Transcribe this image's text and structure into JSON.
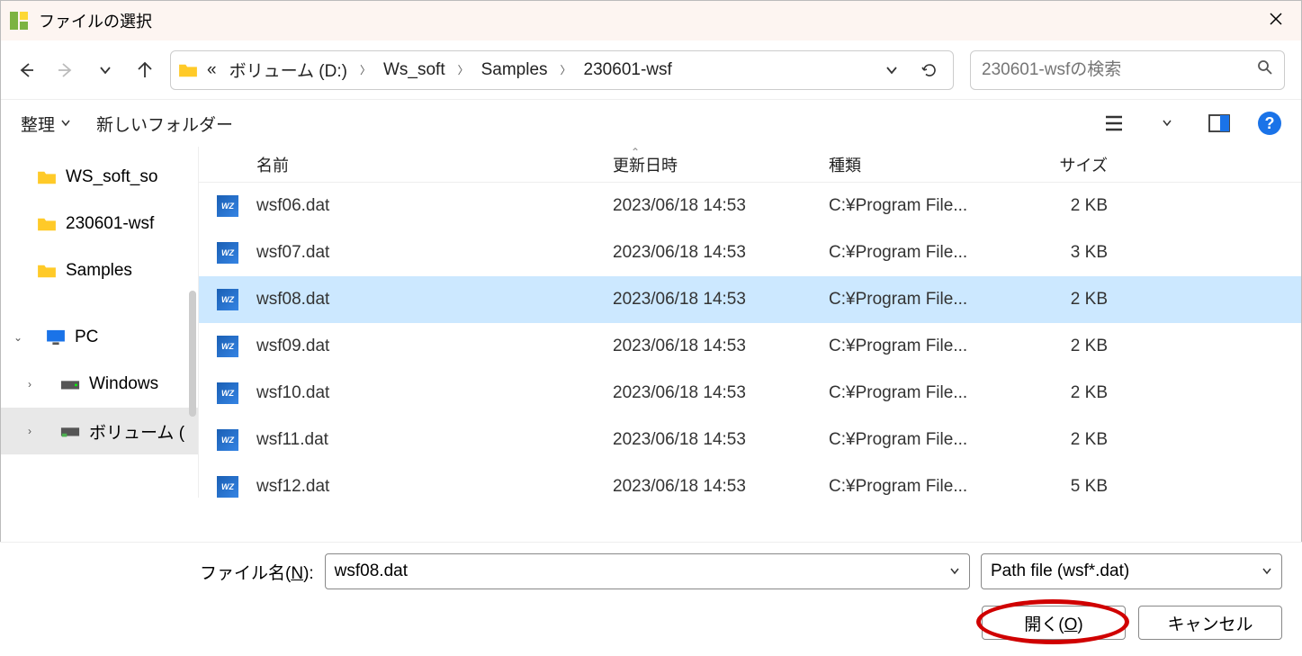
{
  "titlebar": {
    "title": "ファイルの選択"
  },
  "breadcrumb": {
    "parts": [
      "ボリューム (D:)",
      "Ws_soft",
      "Samples",
      "230601-wsf"
    ]
  },
  "search": {
    "placeholder": "230601-wsfの検索"
  },
  "toolbar": {
    "organize": "整理",
    "newfolder": "新しいフォルダー"
  },
  "sidebar": {
    "items": [
      {
        "label": "WS_soft_so"
      },
      {
        "label": "230601-wsf"
      },
      {
        "label": "Samples"
      }
    ],
    "pc": "PC",
    "drives": [
      {
        "label": "Windows"
      },
      {
        "label": "ボリューム ("
      }
    ]
  },
  "columns": {
    "name": "名前",
    "date": "更新日時",
    "type": "種類",
    "size": "サイズ"
  },
  "files": [
    {
      "name": "wsf06.dat",
      "date": "2023/06/18 14:53",
      "type": "C:¥Program File...",
      "size": "2 KB",
      "selected": false
    },
    {
      "name": "wsf07.dat",
      "date": "2023/06/18 14:53",
      "type": "C:¥Program File...",
      "size": "3 KB",
      "selected": false
    },
    {
      "name": "wsf08.dat",
      "date": "2023/06/18 14:53",
      "type": "C:¥Program File...",
      "size": "2 KB",
      "selected": true
    },
    {
      "name": "wsf09.dat",
      "date": "2023/06/18 14:53",
      "type": "C:¥Program File...",
      "size": "2 KB",
      "selected": false
    },
    {
      "name": "wsf10.dat",
      "date": "2023/06/18 14:53",
      "type": "C:¥Program File...",
      "size": "2 KB",
      "selected": false
    },
    {
      "name": "wsf11.dat",
      "date": "2023/06/18 14:53",
      "type": "C:¥Program File...",
      "size": "2 KB",
      "selected": false
    },
    {
      "name": "wsf12.dat",
      "date": "2023/06/18 14:53",
      "type": "C:¥Program File...",
      "size": "5 KB",
      "selected": false
    }
  ],
  "footer": {
    "filename_label": "ファイル名(N):",
    "filename_value": "wsf08.dat",
    "filetype": "Path file (wsf*.dat)",
    "open": "開く(O)",
    "cancel": "キャンセル"
  }
}
